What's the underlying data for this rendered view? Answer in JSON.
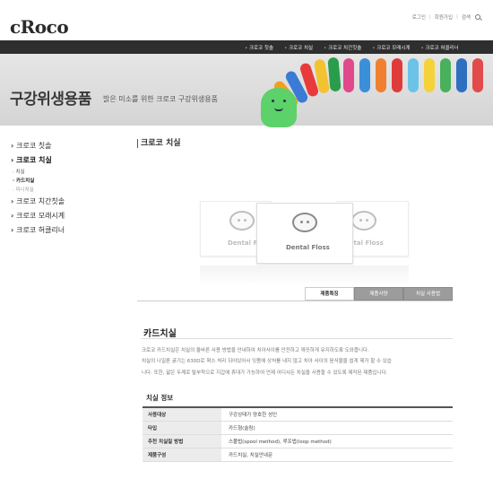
{
  "header": {
    "logo": "cRoco",
    "util": [
      "로그인",
      "회원가입",
      "검색"
    ]
  },
  "gnb": [
    "크로코 칫솔",
    "크로코 치실",
    "크로코 치간칫솔",
    "크로코 모래시계",
    "크로코 혀클리너"
  ],
  "banner": {
    "title": "구강위생용품",
    "subtitle": "밝은 미소를 위한 크로코 구강위생용품"
  },
  "sidebar": {
    "items": [
      {
        "label": "크로코 칫솔"
      },
      {
        "label": "크로코 치실"
      },
      {
        "label": "치실"
      },
      {
        "label": "카드치실"
      },
      {
        "label": "미니치실"
      },
      {
        "label": "크로코 치간칫솔"
      },
      {
        "label": "크로코 모래시계"
      },
      {
        "label": "크로코 혀클리너"
      }
    ]
  },
  "main": {
    "page_title": "크로코 치실",
    "product_cards": [
      "Dental Floss",
      "Dental Floss",
      "Dental Floss"
    ],
    "tabs": [
      "제품특징",
      "제품사양",
      "치실 사용법"
    ],
    "section_title": "카드치실",
    "description": [
      "크로코 카드치실은 치실의 올바른 사용 방법을 안내하여 치아사이를 안전하고 깨끗하게 유지하도록 도와줍니다.",
      "치실의 나일론 굵기는 630D로 왁스 처리 되어있어서 잇몸에 상처를 내지 않고 치아 사이의 음식물을 쉽게 제거 할 수 있습",
      "니다. 또한, 얇은 두께로 탈부착으로 지갑에 휴대가 가능하여 언제 어디서든 치실을 사용할 수 있도록 제작된 제품입니다."
    ],
    "spec_title": "치실 정보",
    "spec_rows": [
      {
        "key": "사용대상",
        "value": "구강상태가 양호한 성인"
      },
      {
        "key": "타입",
        "value": "카드형(슬림)"
      },
      {
        "key": "추천 치실질 방법",
        "value": "스풀법(spool method), 루프법(loop method)"
      },
      {
        "key": "제품구성",
        "value": "카드치실, 치실안내문"
      }
    ]
  },
  "colors": {
    "gnb_bg": "#2e2e2e",
    "banner_bg": "#dcdcdc",
    "tab_inactive": "#9c9c9c",
    "mascot": "#5dd16a"
  }
}
